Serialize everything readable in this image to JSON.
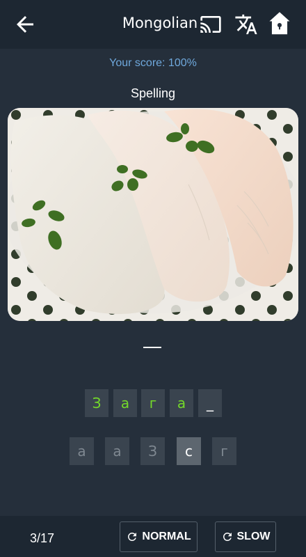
{
  "header": {
    "title": "Mongolian",
    "icons": {
      "back": "arrow-back-icon",
      "cast": "cast-icon",
      "translate": "translate-icon",
      "home": "home-icon"
    }
  },
  "quiz": {
    "score": "Your score: 100%",
    "mode": "Spelling",
    "image": "fish-fillets-with-herbs",
    "answer_dash": "—",
    "slots": [
      "З",
      "а",
      "г",
      "а",
      "_"
    ],
    "choices": [
      "а",
      "а",
      "З",
      "с",
      "г"
    ],
    "active_choice": 3
  },
  "footer": {
    "progress": "3/17",
    "normal_label": "NORMAL",
    "slow_label": "SLOW",
    "icons": {
      "replay": "replay-icon"
    }
  },
  "colors": {
    "background": "#252f3b",
    "bar": "#1d2732",
    "score_text": "#6fa8dc",
    "correct_letter": "#74d92a"
  }
}
